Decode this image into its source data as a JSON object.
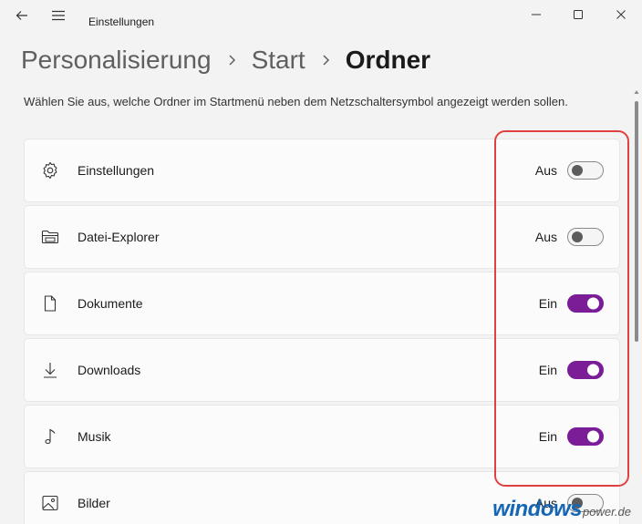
{
  "window": {
    "title": "Einstellungen"
  },
  "breadcrumb": {
    "items": [
      "Personalisierung",
      "Start",
      "Ordner"
    ]
  },
  "description": "Wählen Sie aus, welche Ordner im Startmenü neben dem Netzschaltersymbol angezeigt werden sollen.",
  "folders": [
    {
      "label": "Einstellungen",
      "icon": "gear-icon",
      "state": "Aus",
      "on": false
    },
    {
      "label": "Datei-Explorer",
      "icon": "folder-icon",
      "state": "Aus",
      "on": false
    },
    {
      "label": "Dokumente",
      "icon": "document-icon",
      "state": "Ein",
      "on": true
    },
    {
      "label": "Downloads",
      "icon": "download-icon",
      "state": "Ein",
      "on": true
    },
    {
      "label": "Musik",
      "icon": "music-note-icon",
      "state": "Ein",
      "on": true
    },
    {
      "label": "Bilder",
      "icon": "picture-icon",
      "state": "Aus",
      "on": false
    }
  ],
  "colors": {
    "toggle_on": "#7a1d97",
    "highlight": "#e0413f"
  },
  "watermark": {
    "main": "windows",
    "sub": "power.de"
  }
}
